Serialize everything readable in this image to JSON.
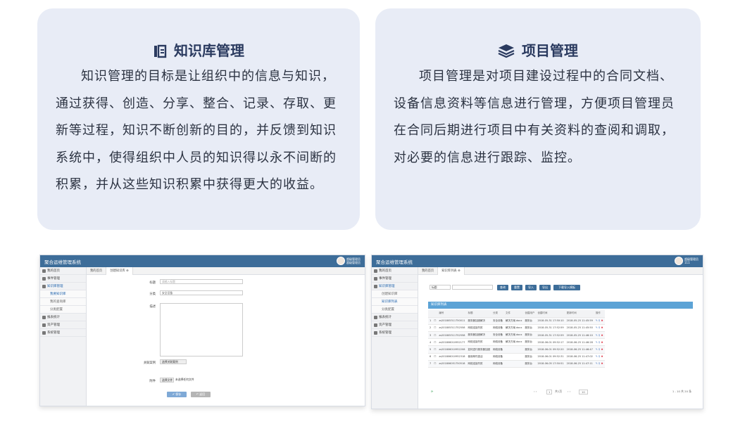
{
  "left_card": {
    "icon": "book-icon",
    "title": "知识库管理",
    "body": "知识管理的目标是让组织中的信息与知识，通过获得、创造、分享、整合、记录、存取、更新等过程，知识不断创新的目的，并反馈到知识系统中，使得组织中人员的知识得以永不间断的积累，并从这些知识积累中获得更大的收益。"
  },
  "right_card": {
    "icon": "layers-icon",
    "title": "项目管理",
    "body": "项目管理是对项目建设过程中的合同文档、设备信息资料等信息进行管理，方便项目管理员在合同后期进行项目中有关资料的查阅和调取，对必要的信息进行跟踪、监控。"
  },
  "shot1": {
    "brand": "聚合运维管理系统",
    "user": "超级管理员 超级管理员",
    "sidebar": [
      "我的首页",
      "事件管理",
      "知识库管理",
      "我要知识库",
      "我的查询库",
      "分类配置",
      "报表统计",
      "资产管理",
      "系统管理"
    ],
    "tabs": [
      "我的首页",
      "创建知识库 ⊗"
    ],
    "form": {
      "title_label": "标题",
      "title_placeholder": "请输入标题",
      "category_label": "分类",
      "category_value": "安全设备",
      "desc_label": "描述",
      "related_label": "关联案例",
      "related_btn": "选择关联案例",
      "attach_label": "附件",
      "attach_btn": "选择文件",
      "attach_text": "未选择任何文件",
      "save_btn": "✔ 保存",
      "return_btn": "↶ 返回"
    }
  },
  "shot2": {
    "brand": "聚合运维管理系统",
    "user": "超级管理员 111",
    "sidebar": [
      "我的首页",
      "事件管理",
      "知识库管理",
      "创建知识库",
      "知识库列表",
      "分类配置",
      "报表统计",
      "资产管理",
      "系统管理"
    ],
    "tabs": [
      "我的首页",
      "知识库列表 ⊗"
    ],
    "filter": {
      "select": "标题",
      "buttons": [
        "查询",
        "重置",
        "导入",
        "导出",
        "下载导入模板"
      ]
    },
    "panel_title": "知识库列表",
    "columns": [
      "",
      "",
      "编号",
      "标题",
      "分类",
      "文件",
      "创建用户",
      "创建时间",
      "更新时间",
      "操作"
    ],
    "rows": [
      [
        "1",
        "☐",
        "zs201805311750011",
        "服务器加固解决",
        "安全设备",
        "解决方案.docx",
        "服务台",
        "2018-05-31 17:50:10",
        "2018-05-25 11:45:59"
      ],
      [
        "2",
        "☐",
        "zs201805311752558",
        "网络连接失败",
        "网络设备",
        "解决方案.docx",
        "服务台",
        "2018-05-31 17:52:59",
        "2018-05-25 11:45:50"
      ],
      [
        "3",
        "☐",
        "zs201805311752558",
        "服务器加固解决",
        "安全设备",
        "解决方案.docx",
        "服务台",
        "2018-05-31 17:52:59",
        "2018-05-25 11:46:10"
      ],
      [
        "4",
        "☐",
        "zs201806010952177",
        "网络连接失败",
        "网络设备",
        "解决方案.docx",
        "服务台",
        "2018-06-01 09:52:17",
        "2018-06-25 11:46:28"
      ],
      [
        "5",
        "☐",
        "zs201806010952208",
        "如何进行服务器加固",
        "网络设备",
        "",
        "服务台",
        "2018-06-01 09:52:20",
        "2018-06-25 11:46:47"
      ],
      [
        "6",
        "☐",
        "zs201806010952318",
        "使用邮件激活",
        "网络设备",
        "",
        "服务台",
        "2018-06-01 09:52:31",
        "2018-06-25 11:47:02"
      ],
      [
        "7",
        "☐",
        "zs201806051750518",
        "网络连接失败",
        "网络设备",
        "",
        "服务台",
        "2018-06-05 17:50:51",
        "2018-06-25 11:47:11"
      ]
    ],
    "pager": {
      "page": "1",
      "of": "共1页",
      "size": "10",
      "info": "1 - 10 共 20 条"
    }
  }
}
